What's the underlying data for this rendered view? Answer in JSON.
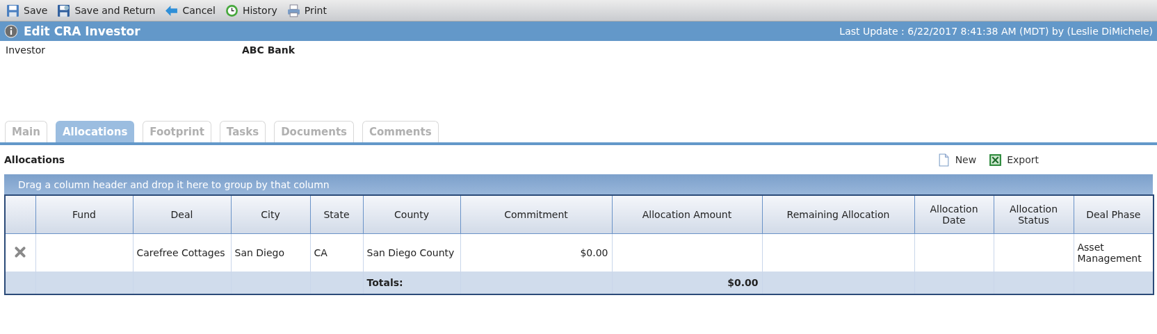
{
  "toolbar": [
    {
      "kind": "save",
      "label": "Save"
    },
    {
      "kind": "save_return",
      "label": "Save and Return"
    },
    {
      "kind": "cancel",
      "label": "Cancel"
    },
    {
      "kind": "history",
      "label": "History"
    },
    {
      "kind": "print",
      "label": "Print"
    }
  ],
  "title": "Edit CRA Investor",
  "last_update": "Last Update : 6/22/2017 8:41:38 AM (MDT) by (Leslie DiMichele)",
  "fields": [
    {
      "label": "Investor",
      "value": "ABC Bank"
    }
  ],
  "tabs": [
    {
      "label": "Main",
      "selected": false
    },
    {
      "label": "Allocations",
      "selected": true
    },
    {
      "label": "Footprint",
      "selected": false
    },
    {
      "label": "Tasks",
      "selected": false
    },
    {
      "label": "Documents",
      "selected": false
    },
    {
      "label": "Comments",
      "selected": false
    }
  ],
  "section_title": "Allocations",
  "actions": [
    {
      "kind": "new",
      "label": "New"
    },
    {
      "kind": "export",
      "label": "Export"
    }
  ],
  "group_hint": "Drag a column header and drop it here to group by that column",
  "table": {
    "columns": [
      {
        "label": "Fund",
        "kind": "text"
      },
      {
        "label": "Deal",
        "kind": "text"
      },
      {
        "label": "City",
        "kind": "text"
      },
      {
        "label": "State",
        "kind": "text"
      },
      {
        "label": "County",
        "kind": "text",
        "total": "Totals:"
      },
      {
        "label": "Commitment",
        "kind": "money"
      },
      {
        "label": "Allocation Amount",
        "kind": "money",
        "total": "$0.00"
      },
      {
        "label": "Remaining Allocation",
        "kind": "money"
      },
      {
        "label": "Allocation Date",
        "kind": "text"
      },
      {
        "label": "Allocation Status",
        "kind": "text"
      },
      {
        "label": "Deal Phase",
        "kind": "text"
      }
    ],
    "rows": [
      {
        "cells": [
          null,
          "Carefree Cottages",
          "San Diego",
          "CA",
          "San Diego County",
          "$0.00",
          null,
          null,
          null,
          null,
          "Asset Management"
        ]
      }
    ]
  }
}
